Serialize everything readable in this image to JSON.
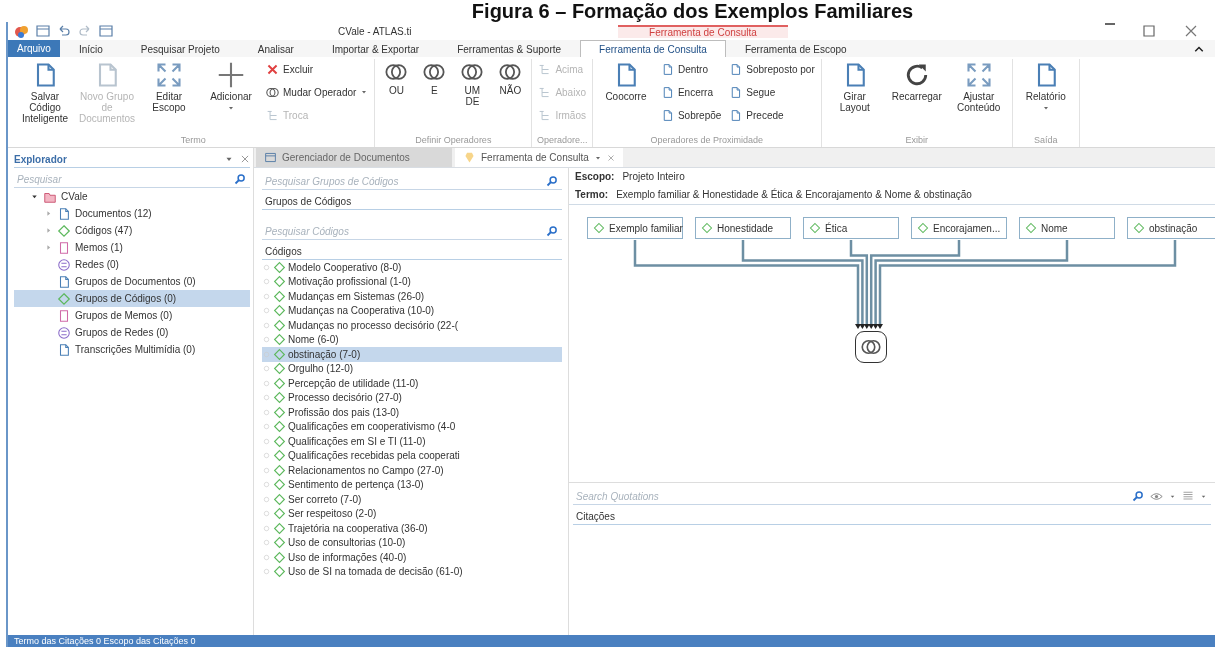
{
  "caption": "Figura 6 – Formação dos Exemplos Familiares",
  "window": {
    "title": "CVale - ATLAS.ti",
    "context_label": "Ferramenta de Consulta"
  },
  "menu_tabs": [
    {
      "label": "Arquivo",
      "kind": "file"
    },
    {
      "label": "Início",
      "kind": "tab",
      "selected": false
    },
    {
      "label": "Pesquisar Projeto",
      "kind": "tab",
      "selected": false
    },
    {
      "label": "Analisar",
      "kind": "tab",
      "selected": false
    },
    {
      "label": "Importar & Exportar",
      "kind": "tab",
      "selected": false
    },
    {
      "label": "Ferramentas & Suporte",
      "kind": "tab",
      "selected": false
    },
    {
      "label": "Ferramenta de Consulta",
      "kind": "tab",
      "selected": true
    },
    {
      "label": "Ferramenta de Escopo",
      "kind": "tab",
      "selected": false
    }
  ],
  "ribbon": [
    {
      "label": "Termo",
      "buttons": [
        {
          "label": "Salvar Código Inteligente",
          "kind": "large",
          "disabled": false,
          "dropdown": false
        },
        {
          "label": "Novo Grupo de Documentos",
          "kind": "large",
          "disabled": true,
          "dropdown": false
        },
        {
          "label": "Editar Escopo",
          "kind": "large",
          "disabled": false,
          "dropdown": false
        },
        {
          "label": "Adicionar",
          "kind": "large",
          "disabled": false,
          "dropdown": true
        },
        {
          "label": "Excluir",
          "kind": "small",
          "disabled": false,
          "dropdown": false
        },
        {
          "label": "Mudar Operador",
          "kind": "small",
          "disabled": false,
          "dropdown": true
        },
        {
          "label": "Troca",
          "kind": "small",
          "disabled": true,
          "dropdown": false
        }
      ]
    },
    {
      "label": "Definir Operadores",
      "buttons": [
        {
          "label": "OU",
          "kind": "operator",
          "disabled": false,
          "dropdown": false
        },
        {
          "label": "E",
          "kind": "operator",
          "disabled": false,
          "dropdown": false
        },
        {
          "label": "UM DE",
          "kind": "operator",
          "disabled": false,
          "dropdown": false
        },
        {
          "label": "NÃO",
          "kind": "operator",
          "disabled": false,
          "dropdown": false
        }
      ]
    },
    {
      "label": "Operadore...",
      "buttons": [
        {
          "label": "Acima",
          "kind": "small",
          "disabled": true,
          "dropdown": false
        },
        {
          "label": "Abaixo",
          "kind": "small",
          "disabled": true,
          "dropdown": false
        },
        {
          "label": "Irmãos",
          "kind": "small",
          "disabled": true,
          "dropdown": false
        }
      ]
    },
    {
      "label": "Operadores de Proximidade",
      "buttons": [
        {
          "label": "Coocorre",
          "kind": "large",
          "disabled": false,
          "dropdown": false
        },
        {
          "label": "Dentro",
          "kind": "small",
          "disabled": false,
          "dropdown": false
        },
        {
          "label": "Encerra",
          "kind": "small",
          "disabled": false,
          "dropdown": false
        },
        {
          "label": "Sobrepõe",
          "kind": "small",
          "disabled": false,
          "dropdown": false
        },
        {
          "label": "Sobreposto por",
          "kind": "small",
          "disabled": false,
          "dropdown": false
        },
        {
          "label": "Segue",
          "kind": "small",
          "disabled": false,
          "dropdown": false
        },
        {
          "label": "Precede",
          "kind": "small",
          "disabled": false,
          "dropdown": false
        }
      ]
    },
    {
      "label": "Exibir",
      "buttons": [
        {
          "label": "Girar Layout",
          "kind": "large",
          "disabled": false,
          "dropdown": false
        },
        {
          "label": "Recarregar",
          "kind": "large",
          "disabled": false,
          "dropdown": false
        },
        {
          "label": "Ajustar Conteúdo",
          "kind": "large",
          "disabled": false,
          "dropdown": false
        }
      ]
    },
    {
      "label": "Saída",
      "buttons": [
        {
          "label": "Relatório",
          "kind": "large",
          "disabled": false,
          "dropdown": true
        }
      ]
    }
  ],
  "explorer": {
    "title": "Explorador",
    "search_placeholder": "Pesquisar",
    "root": {
      "label": "CVale",
      "expanded": true,
      "children": [
        {
          "label": "Documentos (12)",
          "expandable": true,
          "selected": false
        },
        {
          "label": "Códigos (47)",
          "expandable": true,
          "selected": false
        },
        {
          "label": "Memos (1)",
          "expandable": true,
          "selected": false
        },
        {
          "label": "Redes (0)",
          "expandable": false,
          "selected": false
        },
        {
          "label": "Grupos de Documentos (0)",
          "expandable": false,
          "selected": false
        },
        {
          "label": "Grupos de Códigos (0)",
          "expandable": false,
          "selected": true
        },
        {
          "label": "Grupos de Memos (0)",
          "expandable": false,
          "selected": false
        },
        {
          "label": "Grupos de Redes (0)",
          "expandable": false,
          "selected": false
        },
        {
          "label": "Transcrições Multimídia (0)",
          "expandable": false,
          "selected": false
        }
      ]
    }
  },
  "doc_tabs": [
    {
      "label": "Gerenciador de Documentos",
      "selected": false
    },
    {
      "label": "Ferramenta de Consulta",
      "selected": true
    }
  ],
  "code_groups": {
    "search_placeholder": "Pesquisar Grupos de Códigos",
    "header": "Grupos de Códigos"
  },
  "codes": {
    "search_placeholder": "Pesquisar Códigos",
    "header": "Códigos",
    "items": [
      {
        "label": "Modelo Cooperativo (8-0)",
        "selected": false
      },
      {
        "label": "Motivação profissional (1-0)",
        "selected": false
      },
      {
        "label": "Mudanças em Sistemas (26-0)",
        "selected": false
      },
      {
        "label": "Mudanças na Cooperativa (10-0)",
        "selected": false
      },
      {
        "label": "Mudanças no processo decisório (22-(",
        "selected": false
      },
      {
        "label": "Nome (6-0)",
        "selected": false
      },
      {
        "label": "obstinação (7-0)",
        "selected": true
      },
      {
        "label": "Orgulho (12-0)",
        "selected": false
      },
      {
        "label": "Percepção de utilidade (11-0)",
        "selected": false
      },
      {
        "label": "Processo decisório (27-0)",
        "selected": false
      },
      {
        "label": "Profissão dos pais (13-0)",
        "selected": false
      },
      {
        "label": "Qualificações em cooperativismo (4-0",
        "selected": false
      },
      {
        "label": "Qualificações em SI e TI (11-0)",
        "selected": false
      },
      {
        "label": "Qualificações recebidas pela cooperati",
        "selected": false
      },
      {
        "label": "Relacionamentos no Campo (27-0)",
        "selected": false
      },
      {
        "label": "Sentimento de pertença (13-0)",
        "selected": false
      },
      {
        "label": "Ser correto (7-0)",
        "selected": false
      },
      {
        "label": "Ser respeitoso (2-0)",
        "selected": false
      },
      {
        "label": "Trajetória na cooperativa (36-0)",
        "selected": false
      },
      {
        "label": "Uso de consultorias (10-0)",
        "selected": false
      },
      {
        "label": "Uso de informações (40-0)",
        "selected": false
      },
      {
        "label": "Uso de SI na tomada de decisão (61-0)",
        "selected": false
      }
    ]
  },
  "query": {
    "scope_label": "Escopo:",
    "scope": "Projeto Inteiro",
    "term_label": "Termo:",
    "term": "Exemplo familiar & Honestidade & Ética & Encorajamento & Nome & obstinação",
    "nodes": [
      "Exemplo familiar",
      "Honestidade",
      "Ética",
      "Encorajamen...",
      "Nome",
      "obstinação"
    ]
  },
  "quotations": {
    "search_placeholder": "Search Quotations",
    "header": "Citações"
  },
  "status_bar": "Termo das Citações 0 Escopo das Citações 0"
}
